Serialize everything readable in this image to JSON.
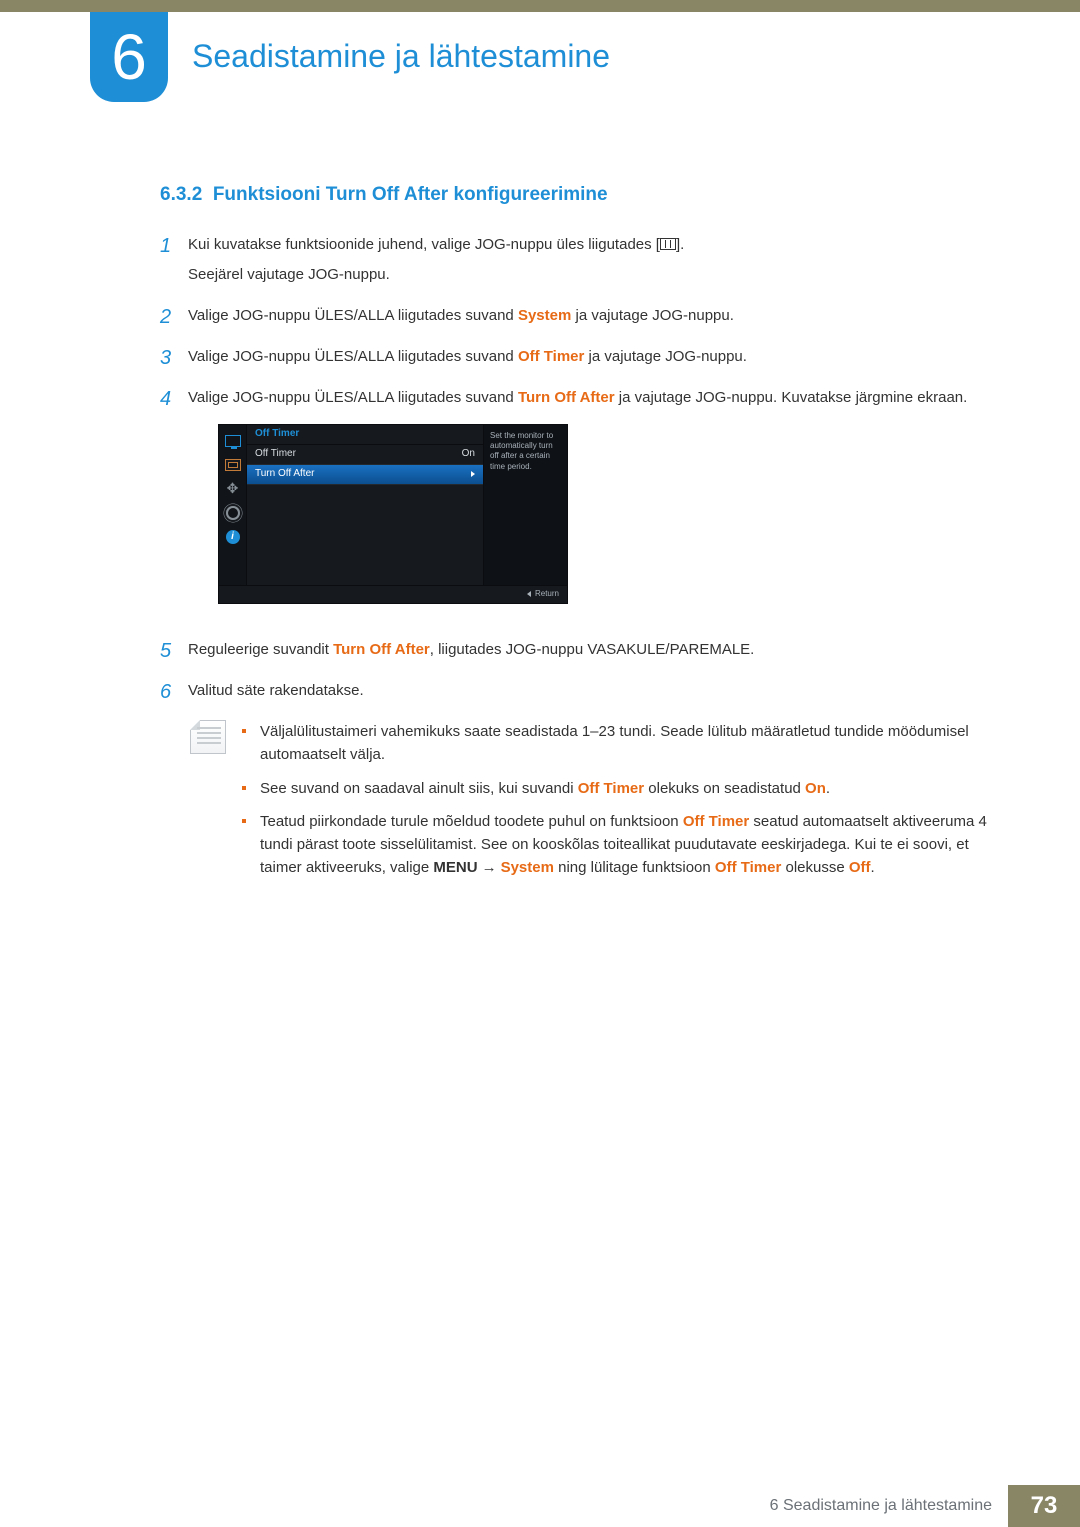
{
  "chapter": {
    "number": "6",
    "title": "Seadistamine ja lähtestamine"
  },
  "section": {
    "number": "6.3.2",
    "title": "Funktsiooni Turn Off After konfigureerimine"
  },
  "steps": {
    "s1": {
      "l1a": "Kui kuvatakse funktsioonide juhend, valige JOG-nuppu üles liigutades [",
      "l1b": "].",
      "l2": "Seejärel vajutage JOG-nuppu."
    },
    "s2": {
      "pre": "Valige JOG-nuppu ÜLES/ALLA liigutades suvand ",
      "kw": "System",
      "post": " ja vajutage JOG-nuppu."
    },
    "s3": {
      "pre": "Valige JOG-nuppu ÜLES/ALLA liigutades suvand ",
      "kw": "Off Timer",
      "post": " ja vajutage JOG-nuppu."
    },
    "s4": {
      "pre": "Valige JOG-nuppu ÜLES/ALLA liigutades suvand ",
      "kw": "Turn Off After",
      "post": " ja vajutage JOG-nuppu. Kuvatakse järgmine ekraan."
    },
    "s5": {
      "pre": "Reguleerige suvandit ",
      "kw": "Turn Off After",
      "post": ", liigutades JOG-nuppu VASAKULE/PAREMALE."
    },
    "s6": {
      "text": "Valitud säte rakendatakse."
    }
  },
  "osd": {
    "title": "Off Timer",
    "row1_label": "Off Timer",
    "row1_value": "On",
    "row2_label": "Turn Off After",
    "desc": "Set the monitor to automatically turn off after a certain time period.",
    "return": "Return"
  },
  "notes": {
    "n1": "Väljalülitustaimeri vahemikuks saate seadistada 1–23 tundi. Seade lülitub määratletud tundide möödumisel automaatselt välja.",
    "n2": {
      "pre": "See suvand on saadaval ainult siis, kui suvandi ",
      "kw1": "Off Timer",
      "mid": " olekuks on seadistatud ",
      "kw2": "On",
      "post": "."
    },
    "n3": {
      "a": "Teatud piirkondade turule mõeldud toodete puhul on funktsioon ",
      "kw1": "Off Timer",
      "b": " seatud automaatselt aktiveeruma 4 tundi pärast toote sisselülitamist. See on kooskõlas toiteallikat puudutavate eeskirjadega. Kui te ei soovi, et taimer aktiveeruks, valige ",
      "menu": "MENU",
      "arrow": "→",
      "kw2": "System",
      "c": " ning lülitage funktsioon ",
      "kw3": "Off Timer",
      "d": " olekusse ",
      "kw4": "Off",
      "e": "."
    }
  },
  "footer": {
    "title": "6 Seadistamine ja lähtestamine",
    "page": "73"
  }
}
